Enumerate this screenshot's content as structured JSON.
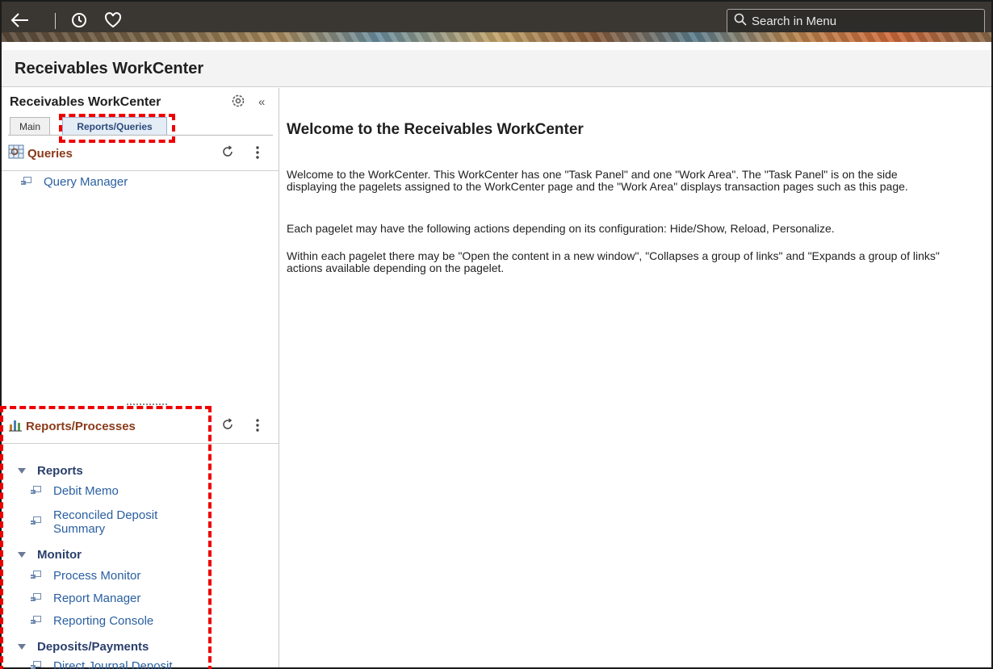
{
  "topbar": {
    "search_placeholder": "Search in Menu",
    "icons": [
      "back-arrow-icon",
      "history-clock-icon",
      "favorites-heart-icon",
      "search-icon"
    ]
  },
  "page": {
    "title": "Receivables WorkCenter"
  },
  "left_panel": {
    "title": "Receivables WorkCenter",
    "collapse_label": "«",
    "tabs": [
      {
        "label": "Main",
        "selected": false
      },
      {
        "label": "Reports/Queries",
        "selected": true
      }
    ],
    "queries": {
      "title": "Queries",
      "links": [
        {
          "label": "Query Manager"
        }
      ]
    },
    "reports_processes": {
      "title": "Reports/Processes",
      "groups": [
        {
          "label": "Reports",
          "links": [
            {
              "label": "Debit Memo"
            },
            {
              "label": "Reconciled Deposit Summary"
            }
          ]
        },
        {
          "label": "Monitor",
          "links": [
            {
              "label": "Process Monitor"
            },
            {
              "label": "Report Manager"
            },
            {
              "label": "Reporting Console"
            }
          ]
        },
        {
          "label": "Deposits/Payments",
          "links": [
            {
              "label": "Direct Journal Deposit"
            }
          ]
        }
      ]
    }
  },
  "main": {
    "welcome_title": "Welcome to the Receivables WorkCenter",
    "paragraphs": [
      "Welcome to the WorkCenter. This WorkCenter has one \"Task Panel\" and one \"Work Area\". The \"Task Panel\" is on the side displaying the pagelets assigned to the WorkCenter page and the \"Work Area\" displays transaction pages such as this page.",
      "Each pagelet may have the following actions depending on its configuration: Hide/Show, Reload, Personalize.",
      "Within each pagelet there may be \"Open the content in a new window\", \"Collapses a group of links\" and \"Expands a group of links\" actions available depending on the pagelet."
    ]
  },
  "colors": {
    "highlight": "#ee0000",
    "pagelet_title": "#8b3a1a",
    "link": "#2a5fa0",
    "group": "#2b3f6b"
  }
}
